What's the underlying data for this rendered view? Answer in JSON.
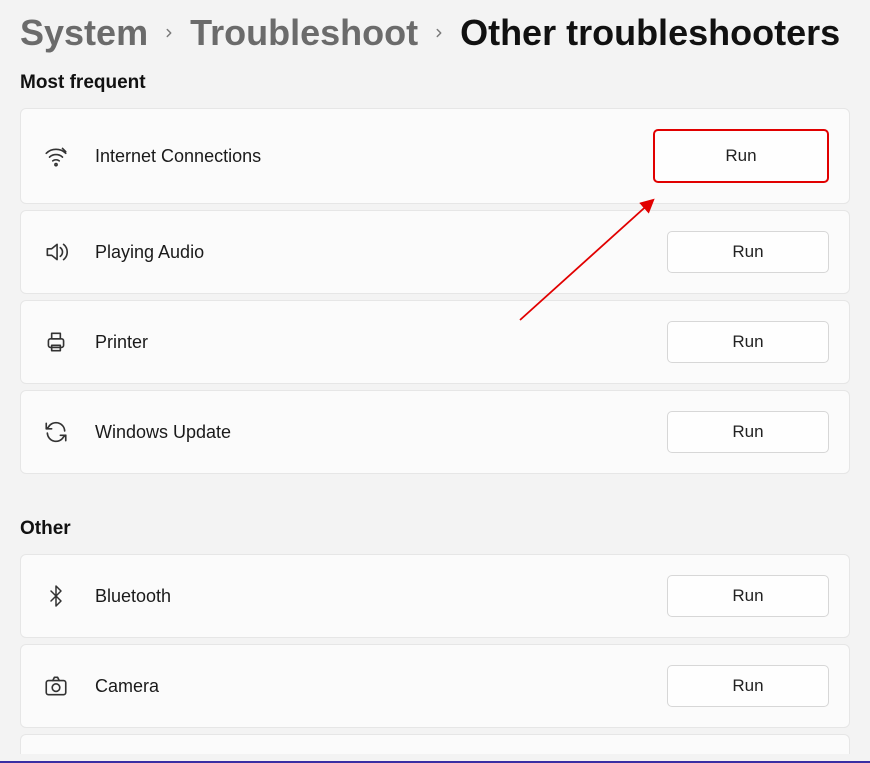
{
  "breadcrumb": {
    "items": [
      {
        "label": "System"
      },
      {
        "label": "Troubleshoot"
      },
      {
        "label": "Other troubleshooters"
      }
    ]
  },
  "sections": {
    "most_frequent": {
      "title": "Most frequent",
      "items": [
        {
          "label": "Internet Connections",
          "button": "Run",
          "icon": "wifi"
        },
        {
          "label": "Playing Audio",
          "button": "Run",
          "icon": "audio"
        },
        {
          "label": "Printer",
          "button": "Run",
          "icon": "printer"
        },
        {
          "label": "Windows Update",
          "button": "Run",
          "icon": "update"
        }
      ]
    },
    "other": {
      "title": "Other",
      "items": [
        {
          "label": "Bluetooth",
          "button": "Run",
          "icon": "bluetooth"
        },
        {
          "label": "Camera",
          "button": "Run",
          "icon": "camera"
        }
      ]
    }
  },
  "annotation": {
    "highlight_index": 0
  }
}
